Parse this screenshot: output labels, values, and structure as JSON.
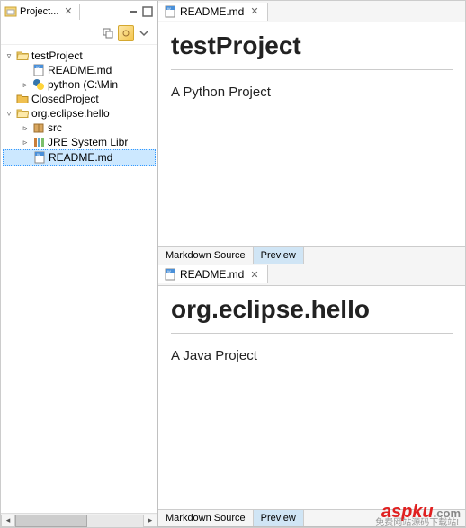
{
  "sidebar": {
    "view_title": "Project...",
    "toolbar": {
      "collapse": "⊟",
      "link": "link"
    },
    "tree": [
      {
        "label": "testProject",
        "icon": "project-open",
        "indent": 0,
        "expander": "▿"
      },
      {
        "label": "README.md",
        "icon": "file-md",
        "indent": 1,
        "expander": ""
      },
      {
        "label": "python  (C:\\Min",
        "icon": "python",
        "indent": 1,
        "expander": "▹"
      },
      {
        "label": "ClosedProject",
        "icon": "project-closed",
        "indent": 0,
        "expander": ""
      },
      {
        "label": "org.eclipse.hello",
        "icon": "project-open",
        "indent": 0,
        "expander": "▿"
      },
      {
        "label": "src",
        "icon": "package",
        "indent": 1,
        "expander": "▹"
      },
      {
        "label": "JRE System Libr",
        "icon": "library",
        "indent": 1,
        "expander": "▹"
      },
      {
        "label": "README.md",
        "icon": "file-md",
        "indent": 1,
        "expander": "",
        "selected": true
      }
    ]
  },
  "editors": [
    {
      "tab": "README.md",
      "heading": "testProject",
      "paragraph": "A Python Project",
      "footer": {
        "source": "Markdown Source",
        "preview": "Preview",
        "active": "preview"
      }
    },
    {
      "tab": "README.md",
      "heading": "org.eclipse.hello",
      "paragraph": "A Java Project",
      "footer": {
        "source": "Markdown Source",
        "preview": "Preview",
        "active": "preview"
      }
    }
  ],
  "watermark": {
    "main": "aspku",
    "suffix": ".com",
    "sub": "免费网站源码下载站!"
  }
}
